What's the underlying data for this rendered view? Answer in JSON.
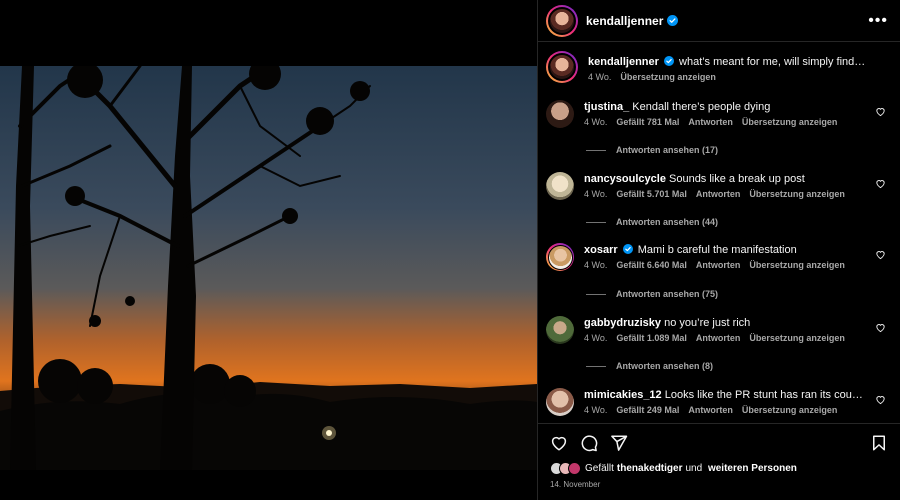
{
  "post": {
    "author": "kendalljenner",
    "more_label": "•••"
  },
  "caption": {
    "user": "kendalljenner",
    "text": "what’s meant for me, will simply find me",
    "age": "4 Wo.",
    "translate": "Übersetzung anzeigen"
  },
  "comments": [
    {
      "user": "tjustina_",
      "verified": false,
      "text": "Kendall there’s people dying",
      "age": "4 Wo.",
      "likes": "Gefällt 781 Mal",
      "reply": "Antworten",
      "translate": "Übersetzung anzeigen",
      "replies": "Antworten ansehen (17)",
      "avatar_color": "#c9a089"
    },
    {
      "user": "nancysoulcycle",
      "verified": false,
      "text": "Sounds like a break up post",
      "age": "4 Wo.",
      "likes": "Gefällt 5.701 Mal",
      "reply": "Antworten",
      "translate": "Übersetzung anzeigen",
      "replies": "Antworten ansehen (44)",
      "avatar_color": "#d8d0b8"
    },
    {
      "user": "xosarr",
      "verified": true,
      "text": "Mami b careful the manifestation",
      "age": "4 Wo.",
      "likes": "Gefällt 6.640 Mal",
      "reply": "Antworten",
      "translate": "Übersetzung anzeigen",
      "replies": "Antworten ansehen (75)",
      "avatar_color": "#d8b58c"
    },
    {
      "user": "gabbydruzisky",
      "verified": false,
      "text": "no you’re just rich",
      "age": "4 Wo.",
      "likes": "Gefällt 1.089 Mal",
      "reply": "Antworten",
      "translate": "Übersetzung anzeigen",
      "replies": "Antworten ansehen (8)",
      "avatar_color": "#4f6a3a"
    },
    {
      "user": "mimicakies_12",
      "verified": false,
      "text": "Looks like the PR stunt has ran its course...",
      "age": "4 Wo.",
      "likes": "Gefällt 249 Mal",
      "reply": "Antworten",
      "translate": "Übersetzung anzeigen",
      "replies": "",
      "avatar_color": "#b98b78"
    }
  ],
  "footer": {
    "likes_prefix": "Gefällt",
    "liked_by": "thenakedtiger",
    "likes_mid": "und",
    "likes_rest": "weiteren Personen",
    "date": "14. November"
  },
  "colors": {
    "verified": "#0095f6",
    "text_secondary": "#a8a8a8",
    "border": "#262626"
  },
  "icons": [
    "heart-icon",
    "comment-icon",
    "share-icon",
    "bookmark-icon",
    "verified-icon",
    "more-icon"
  ]
}
